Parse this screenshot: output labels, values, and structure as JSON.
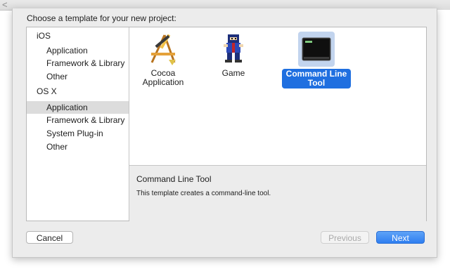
{
  "window": {
    "prompt": "Choose a template for your new project:",
    "back_glyph": "<"
  },
  "sidebar": {
    "groups": [
      {
        "title": "iOS",
        "items": [
          "Application",
          "Framework & Library",
          "Other"
        ]
      },
      {
        "title": "OS X",
        "items": [
          "Application",
          "Framework & Library",
          "System Plug-in",
          "Other"
        ]
      }
    ],
    "selected": "OS X / Application"
  },
  "templates": [
    {
      "label_line1": "Cocoa",
      "label_line2": "Application",
      "icon": "cocoa-app-icon",
      "selected": false
    },
    {
      "label_line1": "Game",
      "label_line2": "",
      "icon": "game-sprite-icon",
      "selected": false
    },
    {
      "label_line1": "Command Line",
      "label_line2": "Tool",
      "icon": "terminal-icon",
      "selected": true
    }
  ],
  "description": {
    "title": "Command Line Tool",
    "text": "This template creates a command-line tool."
  },
  "buttons": {
    "cancel": "Cancel",
    "previous": "Previous",
    "next": "Next"
  },
  "colors": {
    "accent": "#1f6fe0",
    "selection_bg": "#c2d4ee",
    "sidebar_selected": "#dcdcdc"
  }
}
